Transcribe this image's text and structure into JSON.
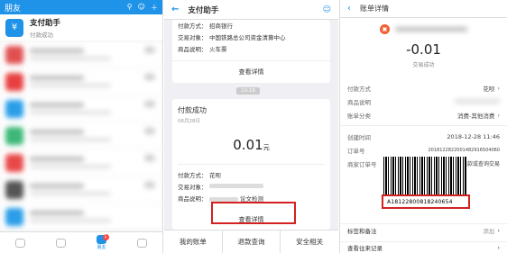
{
  "panel1": {
    "title": "朋友",
    "pinned_chat": {
      "name": "支付助手",
      "sub": "付款成功"
    },
    "tabs": [
      "",
      "",
      "朋友",
      ""
    ],
    "tab_badge": "1"
  },
  "panel2": {
    "title": "支付助手",
    "card1": {
      "rows": [
        {
          "k": "付款方式：",
          "v": "招商银行"
        },
        {
          "k": "交易对象：",
          "v": "中国铁路总公司资金清算中心"
        },
        {
          "k": "商品说明：",
          "v": "火车票"
        }
      ],
      "link": "查看详情"
    },
    "timestamp": "10:18",
    "card2": {
      "title": "付款成功",
      "date": "06月28日",
      "amount": "0.01",
      "unit": "元",
      "rows": [
        {
          "k": "付款方式：",
          "v": "花呗"
        },
        {
          "k": "交易对象：",
          "v": ""
        },
        {
          "k": "商品说明：",
          "v": "论文检测"
        }
      ],
      "link": "查看详情"
    },
    "bottom": [
      "我的账单",
      "退款查询",
      "安全相关"
    ]
  },
  "panel3": {
    "title": "账单详情",
    "amount": "-0.01",
    "status": "交易成功",
    "rows": [
      {
        "k": "付款方式",
        "v": "花呗"
      },
      {
        "k": "商品说明",
        "v": ""
      },
      {
        "k": "账单分类",
        "v": "消费-其他消费"
      }
    ],
    "rows2": [
      {
        "k": "创建时间",
        "v": "2018-12-28 11:46"
      },
      {
        "k": "订单号",
        "v": "2018122822001482916504060"
      },
      {
        "k": "商家订单号",
        "v": "商家可扫码退款或查询交易"
      }
    ],
    "barcode_number": "A1812280081824065​4",
    "tag_label": "标签和备注",
    "tag_action": "添加",
    "more_label": "查看往来记录"
  }
}
